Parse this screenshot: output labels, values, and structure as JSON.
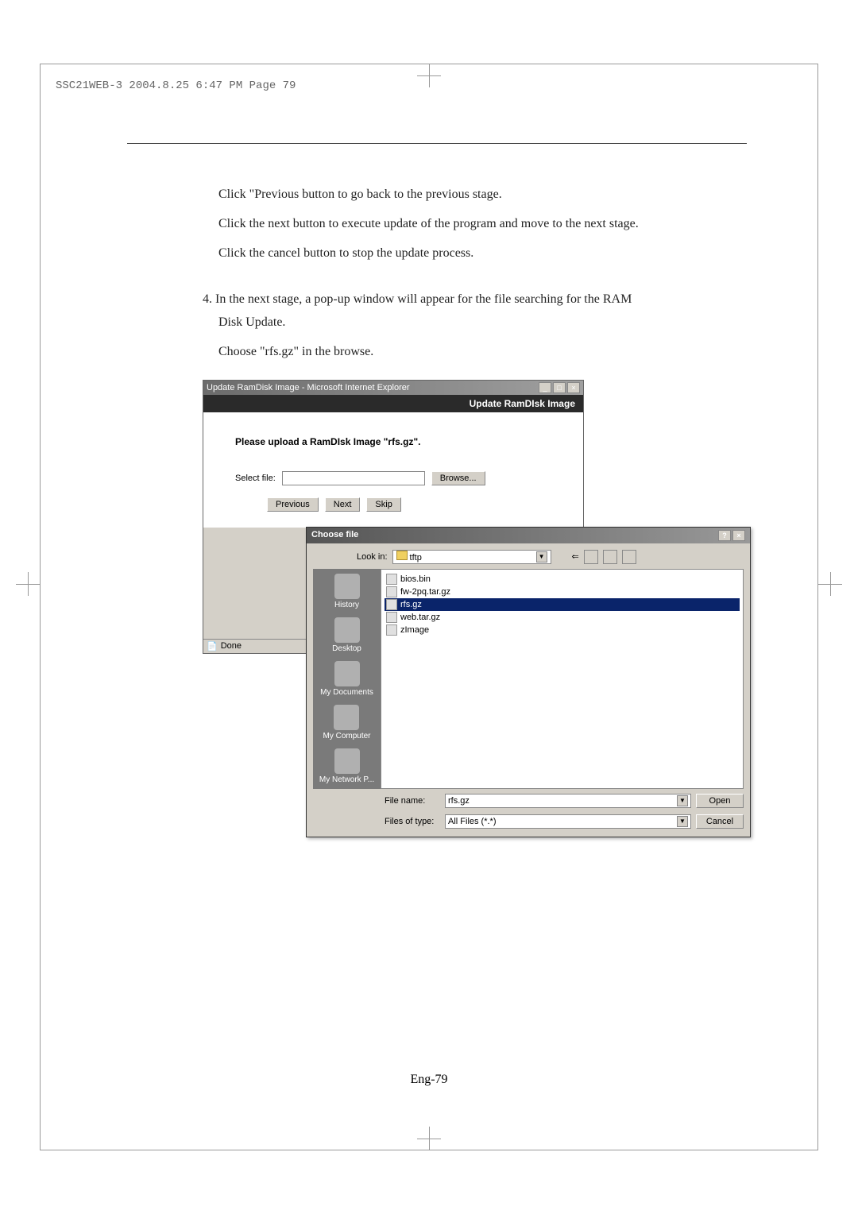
{
  "header": {
    "info": "SSC21WEB-3  2004.8.25  6:47 PM  Page 79"
  },
  "body": {
    "line1": "Click \"Previous button to go back to the previous stage.",
    "line2": "Click the next button to execute update of the program and move to the next stage.",
    "line3": "Click the cancel button to stop the update process.",
    "item4_line1": "4. In the next stage, a pop-up window will appear for the file searching for the RAM",
    "item4_line2": "Disk Update.",
    "item4_line3": "Choose \"rfs.gz\" in the browse."
  },
  "ie_window": {
    "title": "Update RamDisk Image - Microsoft Internet Explorer",
    "header": "Update RamDIsk Image",
    "upload_label": "Please upload a RamDIsk Image \"rfs.gz\".",
    "select_file_label": "Select file:",
    "browse_btn": "Browse...",
    "previous_btn": "Previous",
    "next_btn": "Next",
    "skip_btn": "Skip",
    "status": "Done"
  },
  "choose_dialog": {
    "title": "Choose file",
    "lookin_label": "Look in:",
    "lookin_value": "tftp",
    "sidebar": {
      "history": "History",
      "desktop": "Desktop",
      "mydocs": "My Documents",
      "mycomp": "My Computer",
      "mynet": "My Network P..."
    },
    "files": {
      "f1": "bios.bin",
      "f2": "fw-2pq.tar.gz",
      "f3": "rfs.gz",
      "f4": "web.tar.gz",
      "f5": "zImage"
    },
    "filename_label": "File name:",
    "filename_value": "rfs.gz",
    "filetype_label": "Files of type:",
    "filetype_value": "All Files (*.*)",
    "open_btn": "Open",
    "cancel_btn": "Cancel"
  },
  "page_number": "Eng-79"
}
